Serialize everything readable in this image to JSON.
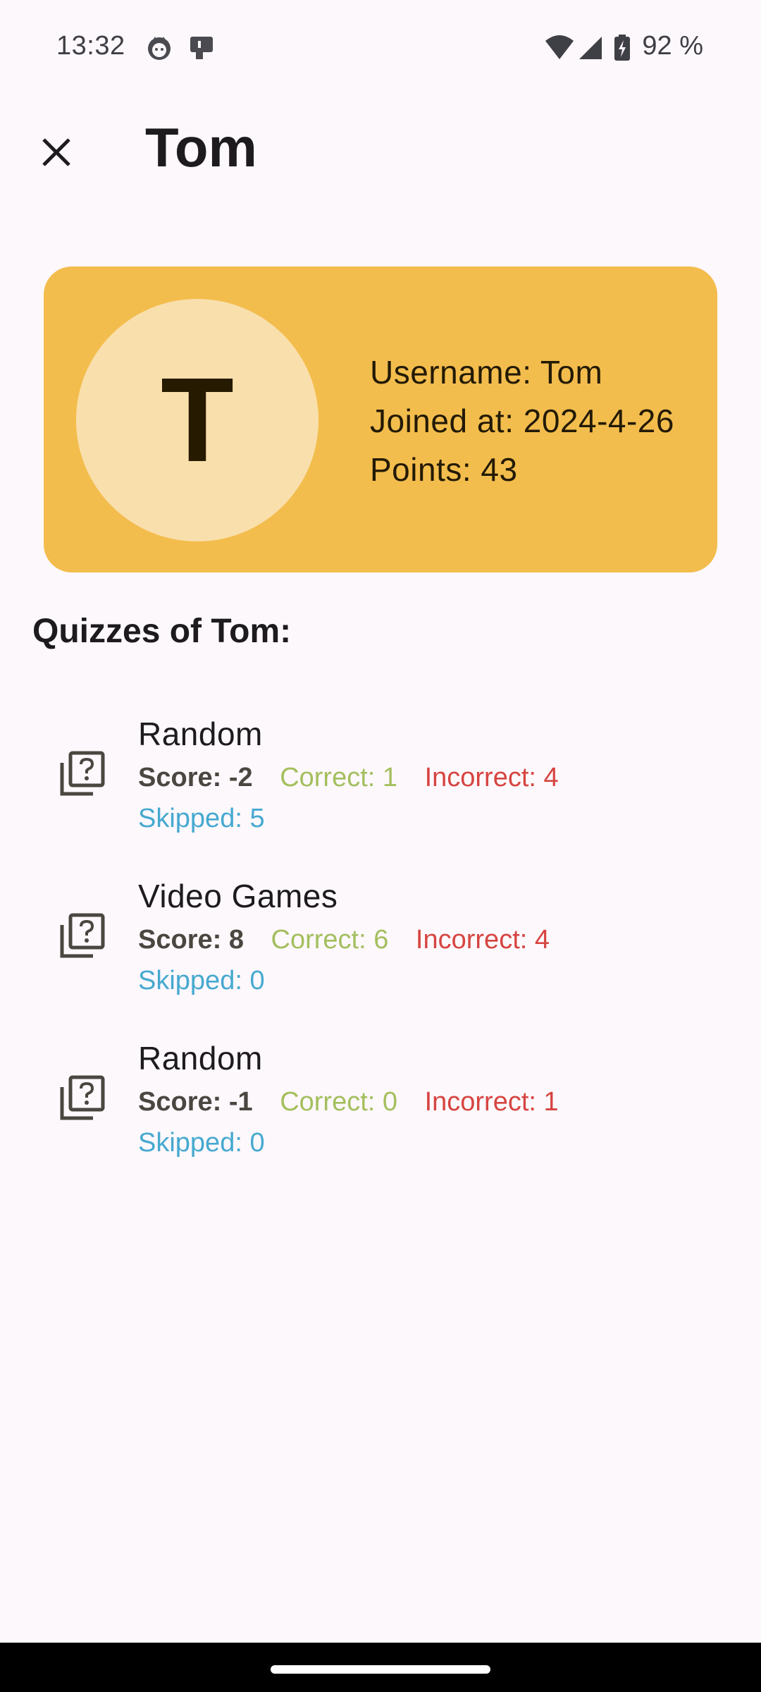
{
  "status_bar": {
    "time": "13:32",
    "battery": "92 %",
    "icons": [
      "cat-notification-icon",
      "device-notification-icon",
      "wifi-icon",
      "signal-icon",
      "battery-charging-icon"
    ]
  },
  "app_bar": {
    "title": "Tom",
    "close_icon": "close-icon"
  },
  "profile": {
    "avatar_letter": "T",
    "username": "Username: Tom",
    "joined": "Joined at: 2024-4-26",
    "points": "Points: 43",
    "card_color": "#f3bd4d",
    "avatar_color": "#f9dfac"
  },
  "quizzes_heading": "Quizzes of Tom:",
  "quizzes": [
    {
      "title": "Random",
      "score": "Score: -2",
      "correct": "Correct: 1",
      "incorrect": "Incorrect: 4",
      "skipped": "Skipped: 5"
    },
    {
      "title": "Video Games",
      "score": "Score: 8",
      "correct": "Correct: 6",
      "incorrect": "Incorrect: 4",
      "skipped": "Skipped: 0"
    },
    {
      "title": "Random",
      "score": "Score: -1",
      "correct": "Correct: 0",
      "incorrect": "Incorrect: 1",
      "skipped": "Skipped: 0"
    }
  ],
  "colors": {
    "correct": "#a3bf5d",
    "incorrect": "#d64541",
    "skipped": "#46a9cf"
  }
}
